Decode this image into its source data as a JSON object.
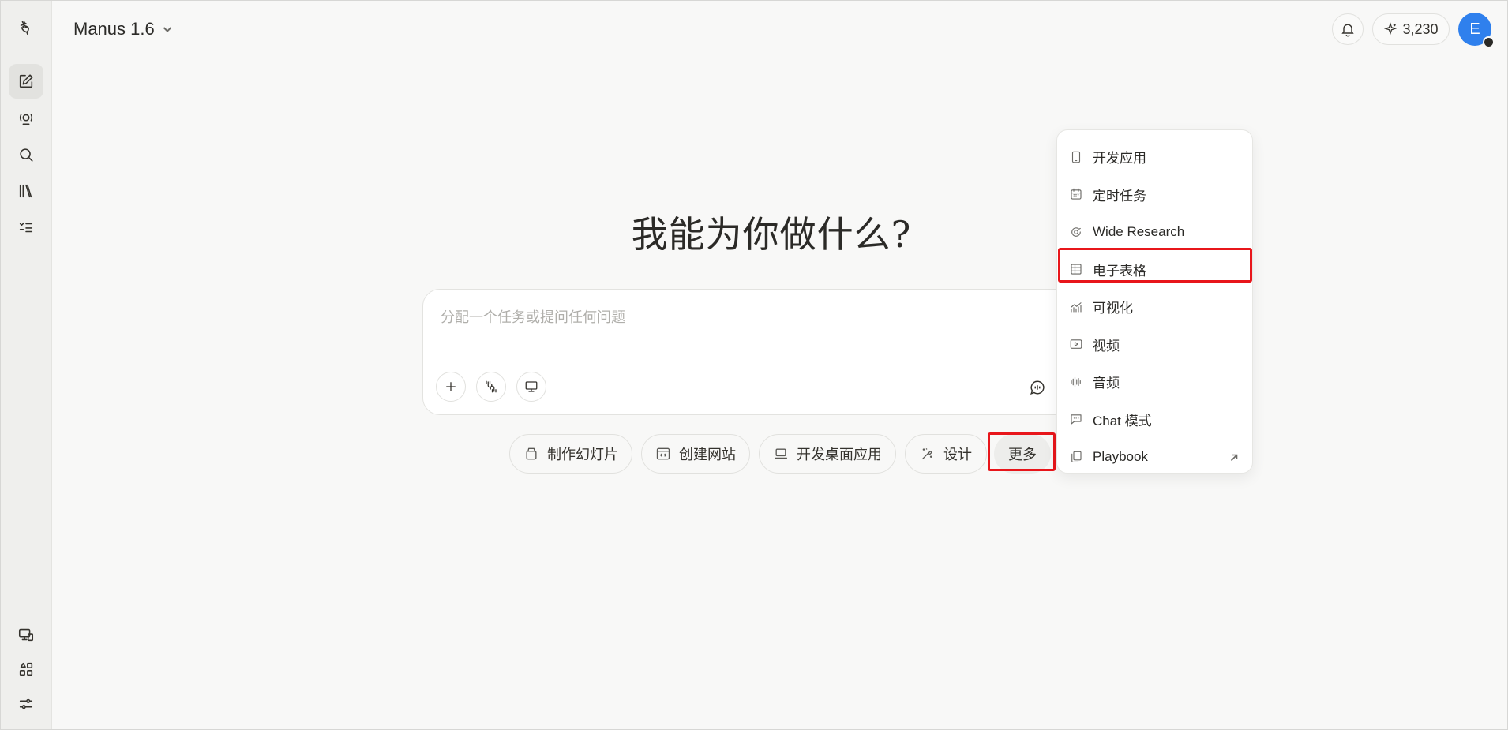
{
  "header": {
    "model_label": "Manus 1.6",
    "credits": "3,230",
    "avatar_initial": "E"
  },
  "sidebar": {
    "top_items": [
      {
        "icon": "new-task-icon"
      },
      {
        "icon": "agents-icon"
      },
      {
        "icon": "search-icon"
      },
      {
        "icon": "library-icon"
      },
      {
        "icon": "tasks-list-icon"
      }
    ],
    "bottom_items": [
      {
        "icon": "devices-icon"
      },
      {
        "icon": "apps-grid-icon"
      },
      {
        "icon": "settings-sliders-icon"
      }
    ]
  },
  "hero": {
    "title": "我能为你做什么?"
  },
  "composer": {
    "placeholder": "分配一个任务或提问任何问题",
    "value": ""
  },
  "quick_actions": [
    {
      "label": "制作幻灯片",
      "icon": "slides-icon"
    },
    {
      "label": "创建网站",
      "icon": "website-icon"
    },
    {
      "label": "开发桌面应用",
      "icon": "laptop-icon"
    },
    {
      "label": "设计",
      "icon": "design-icon"
    },
    {
      "label": "更多",
      "icon": ""
    }
  ],
  "more_menu": {
    "items": [
      {
        "label": "开发应用",
        "icon": "mobile-app-icon"
      },
      {
        "label": "定时任务",
        "icon": "calendar-icon"
      },
      {
        "label": "Wide Research",
        "icon": "wide-research-icon"
      },
      {
        "label": "电子表格",
        "icon": "spreadsheet-icon"
      },
      {
        "label": "可视化",
        "icon": "chart-icon"
      },
      {
        "label": "视频",
        "icon": "video-icon"
      },
      {
        "label": "音频",
        "icon": "audio-icon"
      },
      {
        "label": "Chat 模式",
        "icon": "chat-icon"
      },
      {
        "label": "Playbook",
        "icon": "playbook-icon"
      }
    ]
  },
  "colors": {
    "accent_avatar": "#2f80ed",
    "highlight_box": "#e8161b",
    "background": "#f8f8f7"
  }
}
